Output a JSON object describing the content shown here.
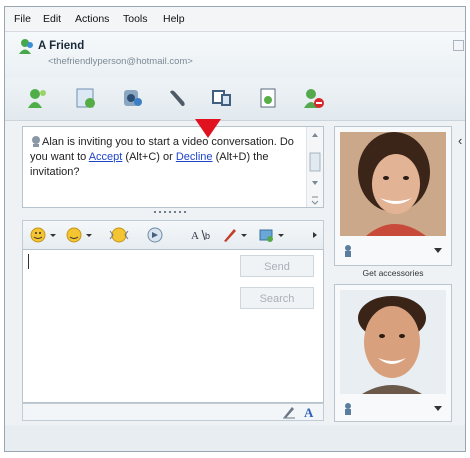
{
  "menu": [
    "File",
    "Edit",
    "Actions",
    "Tools",
    "Help"
  ],
  "contact": {
    "name": "A Friend",
    "email": "<thefriendlyperson@hotmail.com>"
  },
  "toolbar_icons": [
    "invite-icon",
    "send-files-icon",
    "webcam-icon",
    "voice-icon",
    "activities-icon",
    "games-icon",
    "block-icon"
  ],
  "conversation": {
    "pre": "Alan is inviting you to start a video conversation. Do you want to ",
    "accept": "Accept",
    "mid": " (Alt+C) or ",
    "decline": "Decline",
    "post": " (Alt+D) the invitation?"
  },
  "format_icons": [
    "emoticon-icon",
    "wink-icon",
    "nudge-icon",
    "voice-clip-icon",
    "font-icon",
    "background-icon",
    "more-icon"
  ],
  "buttons": {
    "send": "Send",
    "search": "Search"
  },
  "accessories_label": "Get accessories",
  "colors": {
    "accent_arrow": "#e0121f",
    "link": "#1f45c8"
  }
}
